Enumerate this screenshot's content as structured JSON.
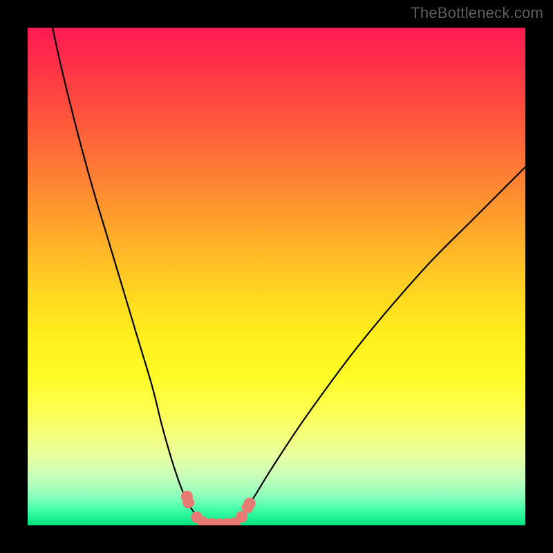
{
  "watermark": {
    "text": "TheBottleneck.com"
  },
  "colors": {
    "frame": "#000000",
    "curve": "#000000",
    "marker_fill": "#e77a72",
    "marker_stroke": "#cc5e56"
  },
  "chart_data": {
    "type": "line",
    "title": "",
    "xlabel": "",
    "ylabel": "",
    "xlim": [
      0,
      100
    ],
    "ylim": [
      0,
      100
    ],
    "grid": false,
    "legend": false,
    "series": [
      {
        "name": "left-branch",
        "x": [
          5,
          7,
          10,
          13,
          16,
          19,
          22,
          25,
          27,
          29,
          30.5,
          31.5,
          32.5,
          33.5,
          34,
          34.5,
          35
        ],
        "y": [
          100,
          91,
          79,
          68,
          58,
          48,
          38,
          28,
          20,
          13,
          8.5,
          6,
          4,
          2.5,
          1.6,
          1.0,
          0.6
        ]
      },
      {
        "name": "right-branch",
        "x": [
          42,
          42.5,
          43,
          43.5,
          44.5,
          46,
          48,
          51,
          55,
          60,
          66,
          73,
          81,
          90,
          100
        ],
        "y": [
          0.6,
          1.0,
          1.7,
          2.6,
          4.2,
          6.5,
          9.8,
          14.5,
          20.5,
          27.5,
          35.5,
          44,
          53,
          62,
          72
        ]
      },
      {
        "name": "valley-floor",
        "x": [
          35,
          36,
          37,
          38,
          39,
          40,
          41,
          42
        ],
        "y": [
          0.6,
          0.35,
          0.25,
          0.22,
          0.22,
          0.25,
          0.35,
          0.6
        ]
      }
    ],
    "markers": [
      {
        "x": 32.0,
        "y": 5.8
      },
      {
        "x": 32.3,
        "y": 4.6
      },
      {
        "x": 34.0,
        "y": 1.6
      },
      {
        "x": 35.3,
        "y": 0.55
      },
      {
        "x": 37.0,
        "y": 0.28
      },
      {
        "x": 38.5,
        "y": 0.22
      },
      {
        "x": 40.0,
        "y": 0.25
      },
      {
        "x": 41.5,
        "y": 0.42
      },
      {
        "x": 43.0,
        "y": 1.7
      },
      {
        "x": 44.2,
        "y": 3.6
      },
      {
        "x": 44.6,
        "y": 4.4
      }
    ]
  }
}
